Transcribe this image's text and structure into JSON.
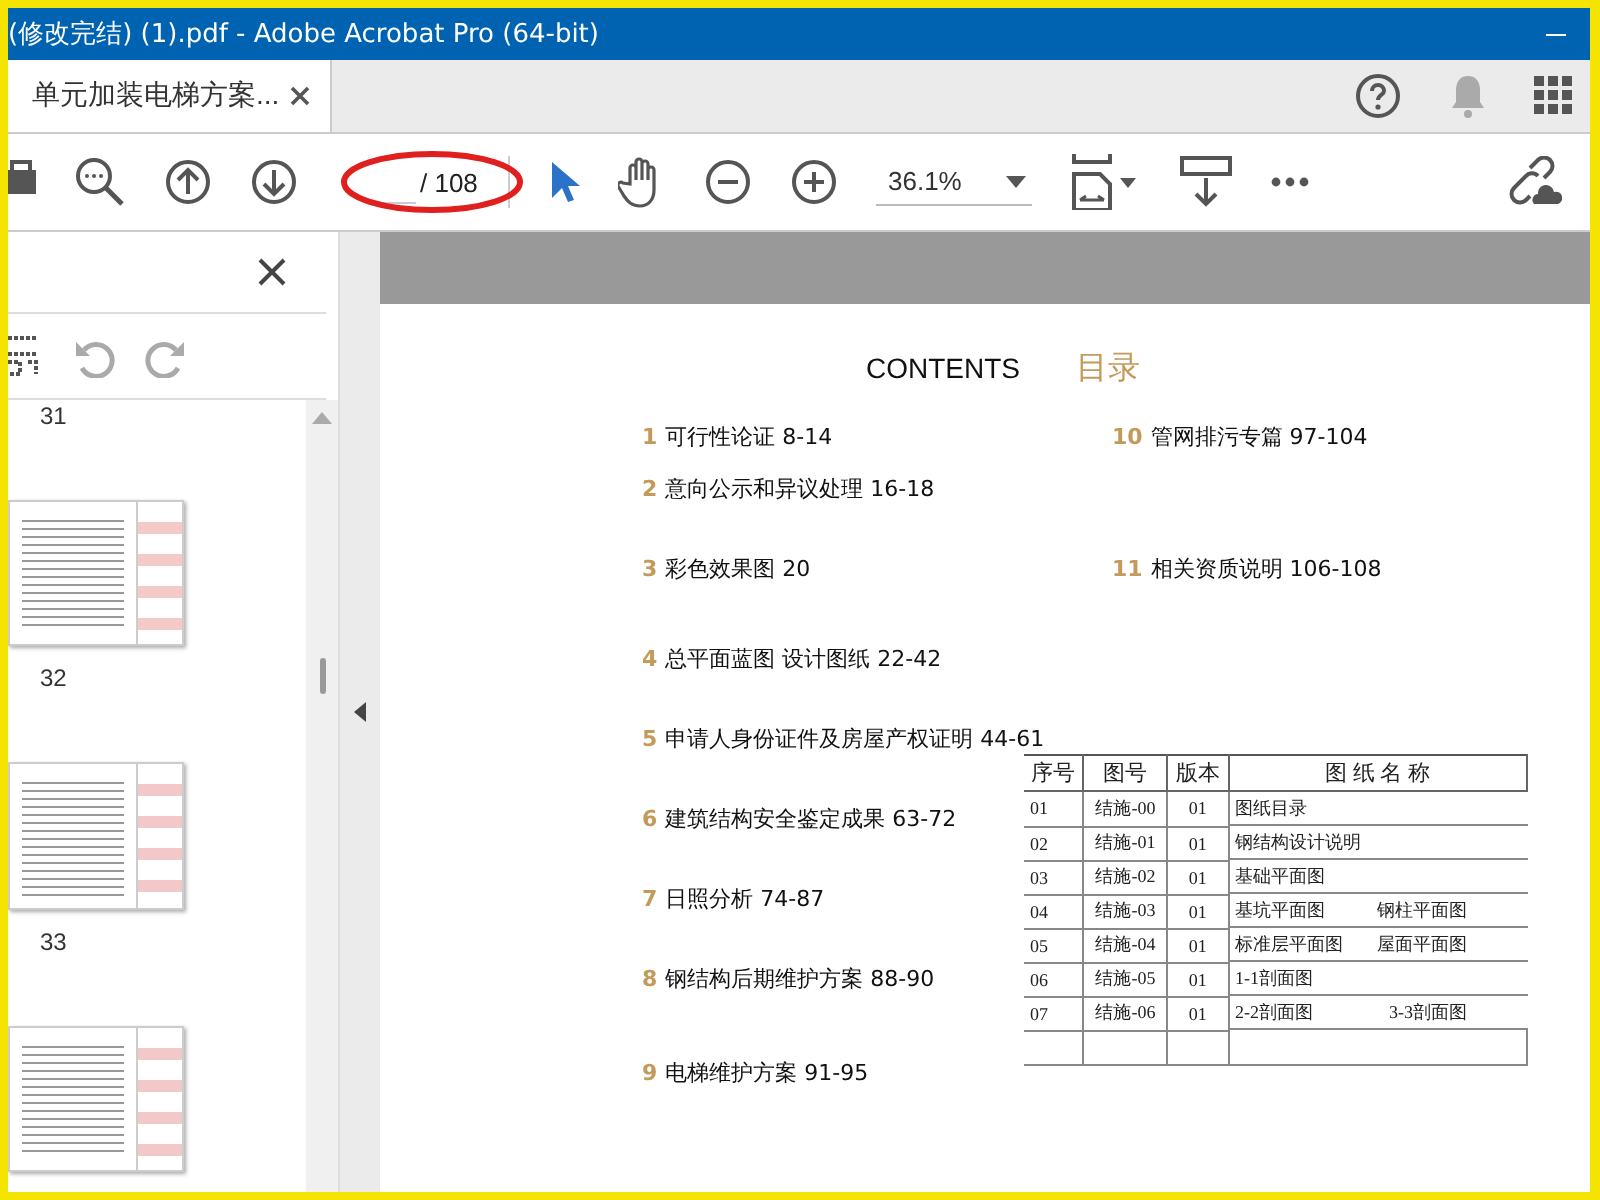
{
  "window": {
    "title": "(修改完结)  (1).pdf - Adobe Acrobat Pro (64-bit)"
  },
  "tabs": [
    {
      "label": "单元加装电梯方案...",
      "selected": true
    }
  ],
  "toolbar": {
    "page_total": "/ 108",
    "zoom": "36.1%"
  },
  "thumbnails": [
    {
      "label": "31"
    },
    {
      "label": "32"
    },
    {
      "label": "33"
    }
  ],
  "document": {
    "heading": "CONTENTS",
    "heading_cn": "目录",
    "contents_left": [
      {
        "number": "1",
        "text": "可行性论证  8-14"
      },
      {
        "number": "2",
        "text": "意向公示和异议处理 16-18"
      },
      {
        "number": "3",
        "text": "彩色效果图     20"
      },
      {
        "number": "4",
        "text": " 总平面蓝图   设计图纸 22-42"
      },
      {
        "number": "5",
        "text": "申请人身份证件及房屋产权证明 44-61"
      },
      {
        "number": "6",
        "text": "建筑结构安全鉴定成果 63-72"
      },
      {
        "number": "7",
        "text": "日照分析  74-87"
      },
      {
        "number": "8",
        "text": "钢结构后期维护方案     88-90"
      },
      {
        "number": "9",
        "text": "电梯维护方案 91-95"
      }
    ],
    "contents_right": [
      {
        "number": "10",
        "text": "管网排污专篇 97-104"
      },
      {
        "number": "11",
        "text": "相关资质说明  106-108"
      }
    ],
    "table": {
      "columns": [
        "序号",
        "图号",
        "版本",
        "图 纸 名 称"
      ],
      "rows": [
        {
          "no": "01",
          "drawing": "结施-00",
          "version": "01",
          "name": "图纸目录"
        },
        {
          "no": "02",
          "drawing": "结施-01",
          "version": "01",
          "name": "钢结构设计说明"
        },
        {
          "no": "03",
          "drawing": "结施-02",
          "version": "01",
          "name": "基础平面图"
        },
        {
          "no": "04",
          "drawing": "结施-03",
          "version": "01",
          "name": "基坑平面图",
          "name_2": "钢柱平面图"
        },
        {
          "no": "05",
          "drawing": "结施-04",
          "version": "01",
          "name": "标准层平面图",
          "name_2": "屋面平面图"
        },
        {
          "no": "06",
          "drawing": "结施-05",
          "version": "01",
          "name": "1-1剖面图"
        },
        {
          "no": "07",
          "drawing": "结施-06",
          "version": "01",
          "name": "2-2剖面图",
          "name_2": "3-3剖面图"
        }
      ]
    }
  }
}
